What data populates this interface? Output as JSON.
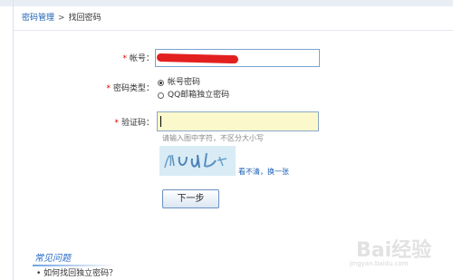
{
  "breadcrumb": {
    "parent": "密码管理",
    "separator": ">",
    "current": "找回密码"
  },
  "form": {
    "account": {
      "label": "帐号：",
      "required_mark": "*",
      "value": ""
    },
    "password_type": {
      "label": "密码类型：",
      "required_mark": "*",
      "options": [
        {
          "label": "帐号密码",
          "checked": true
        },
        {
          "label": "QQ邮箱独立密码",
          "checked": false
        }
      ]
    },
    "captcha": {
      "label": "验证码：",
      "required_mark": "*",
      "value": "",
      "hint": "请输入图中字符，不区分大小写",
      "image_text": "hUdt",
      "refresh_link": "看不清，换一张"
    },
    "next_button": "下一步"
  },
  "faq": {
    "title": "常见问题",
    "items": [
      "• 如何找回独立密码？"
    ]
  },
  "watermark": {
    "main": "Bai经验",
    "sub": "jingyan.baidu.com"
  },
  "colors": {
    "link": "#1b5fb5",
    "required": "#d40000",
    "captcha_bg": "#fbf8cc",
    "redaction": "#e32020"
  }
}
